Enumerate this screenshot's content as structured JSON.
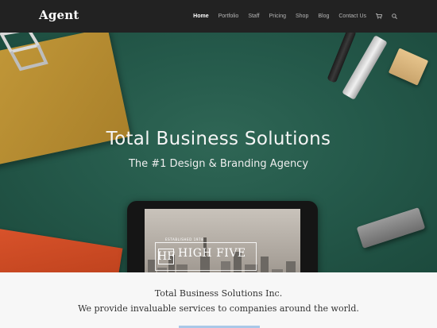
{
  "brand": {
    "logo": "Agent"
  },
  "nav": {
    "items": [
      {
        "label": "Home",
        "active": true
      },
      {
        "label": "Portfolio",
        "active": false
      },
      {
        "label": "Staff",
        "active": false
      },
      {
        "label": "Pricing",
        "active": false
      },
      {
        "label": "Shop",
        "active": false
      },
      {
        "label": "Blog",
        "active": false
      },
      {
        "label": "Contact Us",
        "active": false
      }
    ],
    "icons": [
      "cart-icon",
      "search-icon"
    ]
  },
  "hero": {
    "title": "Total Business Solutions",
    "subtitle": "The #1 Design & Branding Agency",
    "tablet_badge": {
      "top_text": "ESTABLISHED 1978",
      "mark": "HF",
      "text": "HIGH FIVE"
    }
  },
  "info": {
    "line1": "Total Business Solutions Inc.",
    "line2": "We provide invaluable services to companies around the world."
  },
  "colors": {
    "nav_bg": "#222222",
    "hero_bg": "#255a4b",
    "info_bg": "#f7f7f7"
  }
}
